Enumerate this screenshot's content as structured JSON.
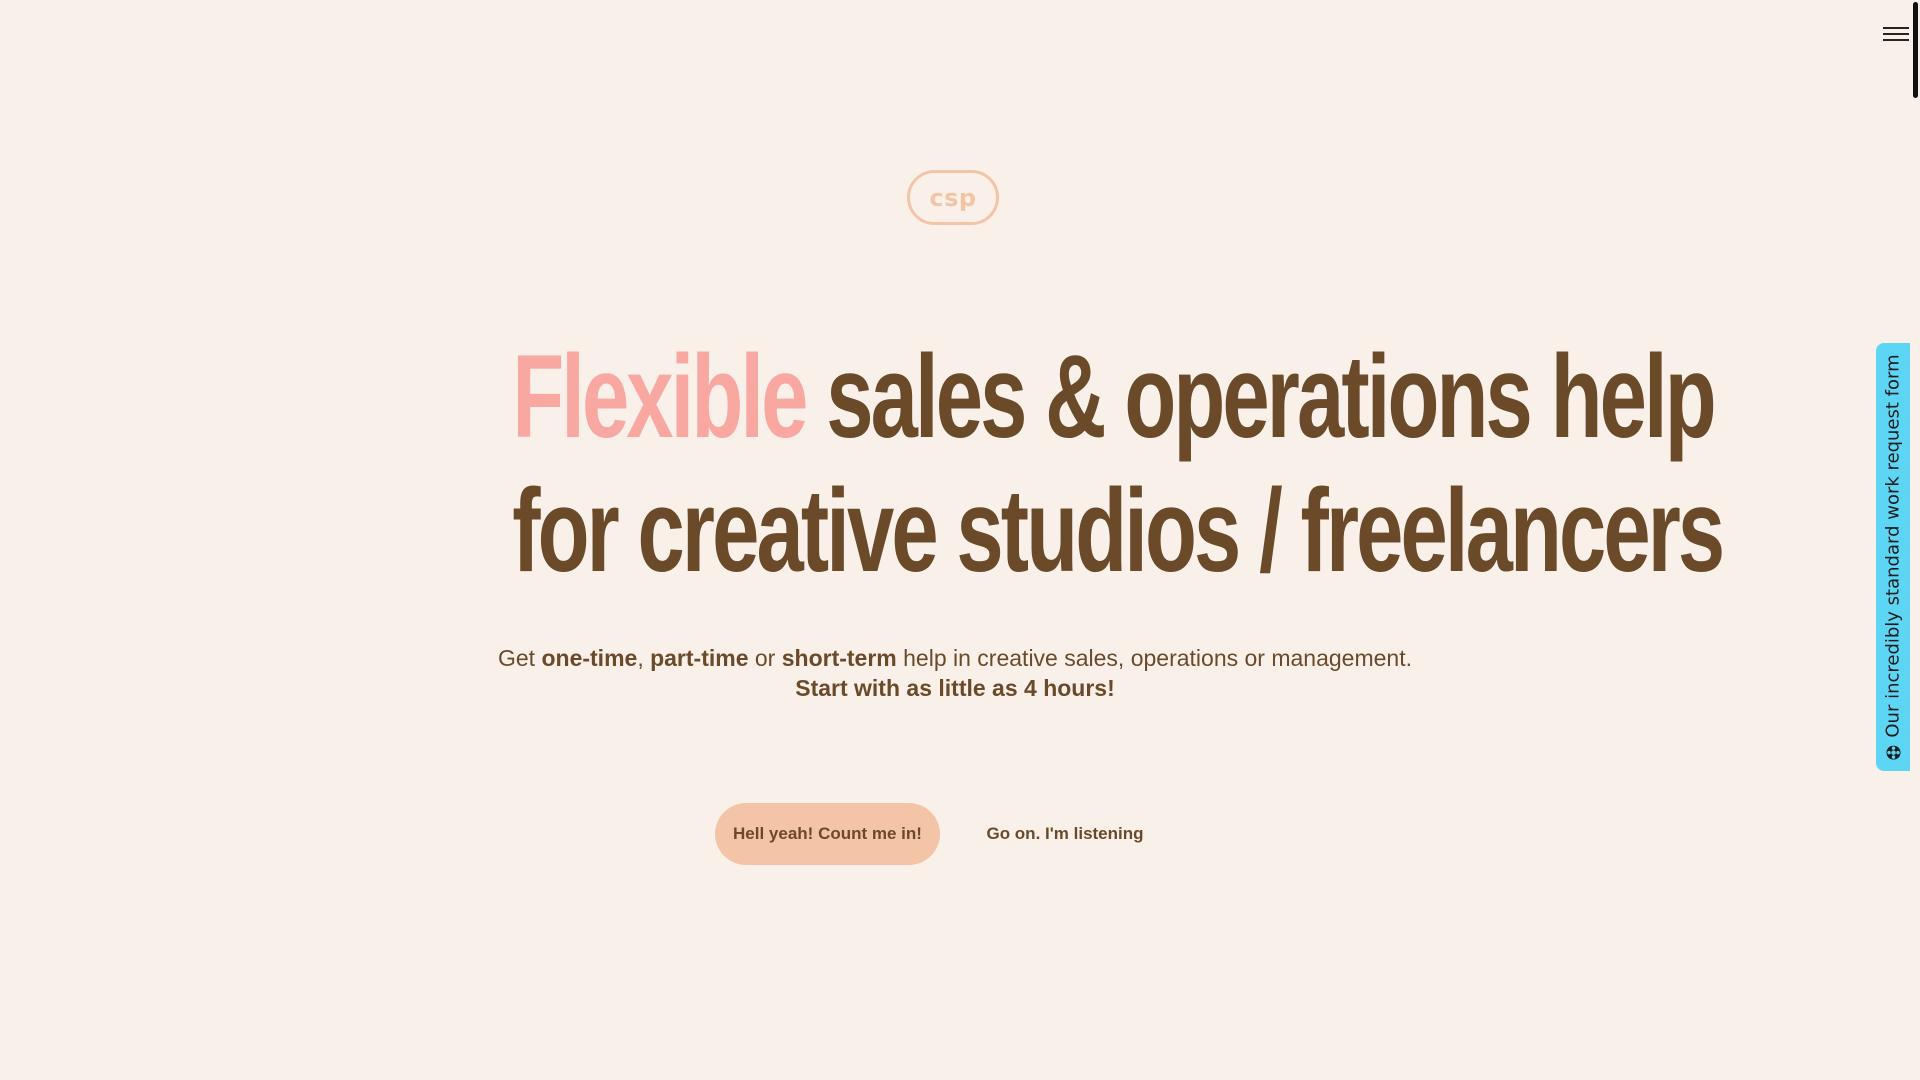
{
  "header": {
    "logo_text": "csp",
    "menu_icon": "hamburger-menu-icon"
  },
  "hero": {
    "headline_accent": "Flexible",
    "headline_rest_line1": "sales & operations help",
    "headline_line2": "for creative studios / freelancers",
    "subhead": {
      "prefix": "Get ",
      "bold1": "one-time",
      "sep1": ", ",
      "bold2": "part-time",
      "sep2": " or ",
      "bold3": "short-term",
      "suffix": " help in creative sales, operations or management.",
      "line2": "Start with as little as 4 hours!"
    },
    "primary_cta": "Hell yeah! Count me in!",
    "secondary_cta": "Go on. I'm listening"
  },
  "side_tab": {
    "label": "Our incredibly standard work request form",
    "icon": "flower-icon"
  },
  "colors": {
    "background": "#f9f1e9",
    "text": "#6b4a2a",
    "accent_pink": "#f9a7a1",
    "peach": "#f3c4a6",
    "side_tab": "#5dd6f5"
  }
}
